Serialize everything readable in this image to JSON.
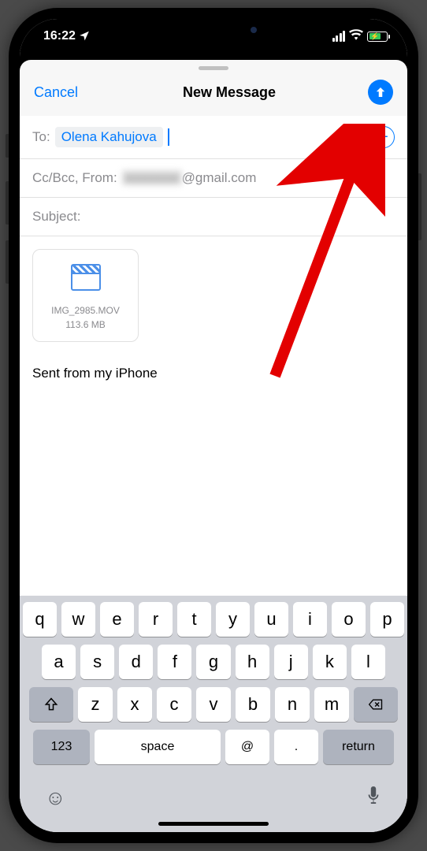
{
  "status_bar": {
    "time": "16:22",
    "location_indicator": "◤"
  },
  "header": {
    "cancel_label": "Cancel",
    "title": "New Message"
  },
  "compose": {
    "to_label": "To:",
    "recipient": "Olena Kahujova",
    "cc_from_label": "Cc/Bcc, From:",
    "from_redacted": "xxxxxxxx",
    "from_domain": "@gmail.com",
    "subject_label": "Subject:",
    "signature": "Sent from my iPhone"
  },
  "attachment": {
    "filename": "IMG_2985.MOV",
    "filesize": "113.6 MB"
  },
  "keyboard": {
    "row1": [
      "q",
      "w",
      "e",
      "r",
      "t",
      "y",
      "u",
      "i",
      "o",
      "p"
    ],
    "row2": [
      "a",
      "s",
      "d",
      "f",
      "g",
      "h",
      "j",
      "k",
      "l"
    ],
    "row3": [
      "z",
      "x",
      "c",
      "v",
      "b",
      "n",
      "m"
    ],
    "k123": "123",
    "space": "space",
    "at": "@",
    "dot": ".",
    "return": "return"
  }
}
